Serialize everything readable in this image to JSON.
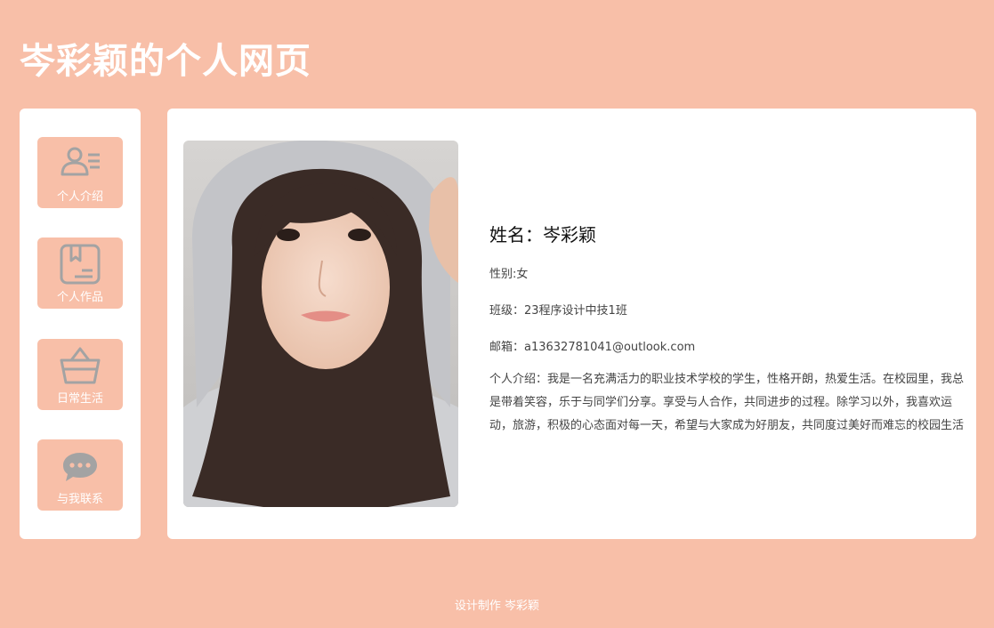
{
  "header": {
    "title": "岑彩颖的个人网页"
  },
  "sidebar": {
    "items": [
      {
        "label": "个人介绍",
        "icon": "person-list-icon"
      },
      {
        "label": "个人作品",
        "icon": "bookmark-book-icon"
      },
      {
        "label": "日常生活",
        "icon": "basket-icon"
      },
      {
        "label": "与我联系",
        "icon": "chat-bubble-icon"
      }
    ]
  },
  "profile": {
    "name": "姓名：岑彩颖",
    "gender": "性别:女",
    "class": "班级：23程序设计中技1班",
    "email": "邮箱：a13632781041@outlook.com",
    "intro": "个人介绍：我是一名充满活力的职业技术学校的学生，性格开朗，热爱生活。在校园里，我总是带着笑容，乐于与同学们分享。享受与人合作，共同进步的过程。除学习以外，我喜欢运动，旅游，积极的心态面对每一天，希望与大家成为好朋友，共同度过美好而难忘的校园生活"
  },
  "footer": {
    "text": "设计制作 岑彩颖"
  },
  "colors": {
    "background": "#f8bfa8",
    "card": "#ffffff",
    "icon": "#a9a9a9"
  }
}
